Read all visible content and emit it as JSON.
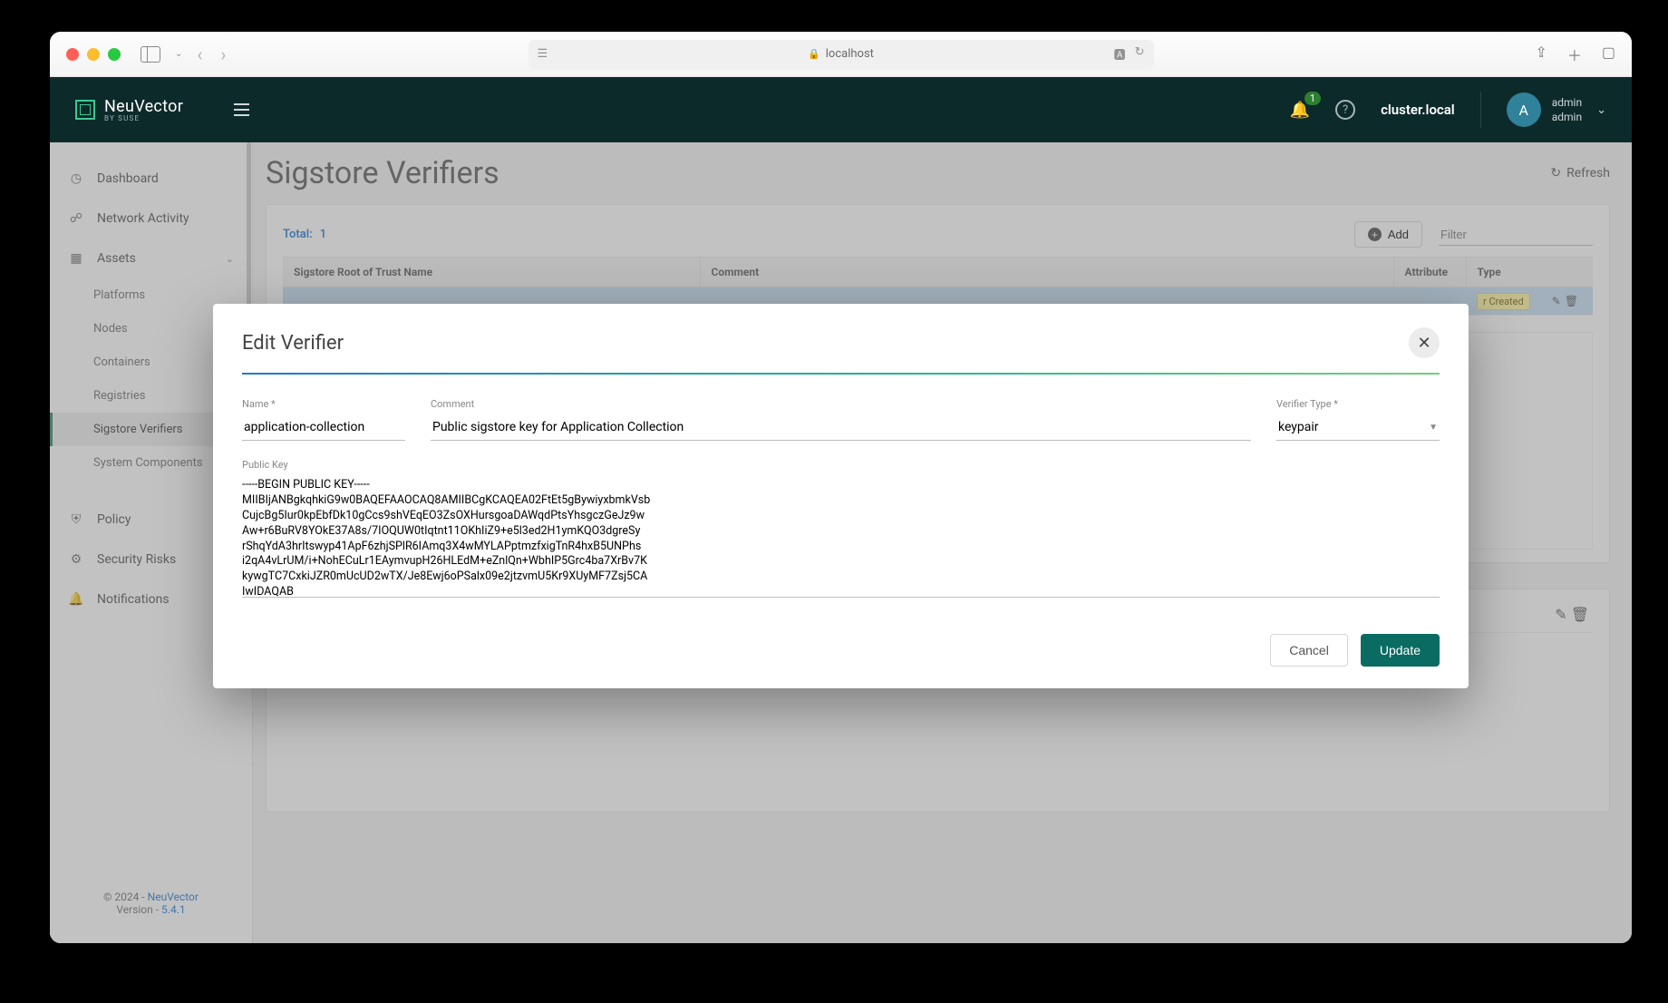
{
  "browser": {
    "url_host": "localhost"
  },
  "header": {
    "logo_text": "NeuVector",
    "logo_sub": "BY SUSE",
    "notification_badge": "1",
    "cluster_name": "cluster.local",
    "avatar_initial": "A",
    "user_line1": "admin",
    "user_line2": "admin"
  },
  "sidebar": {
    "items": [
      {
        "label": "Dashboard"
      },
      {
        "label": "Network Activity"
      },
      {
        "label": "Assets"
      },
      {
        "label": "Platforms"
      },
      {
        "label": "Nodes"
      },
      {
        "label": "Containers"
      },
      {
        "label": "Registries"
      },
      {
        "label": "Sigstore Verifiers"
      },
      {
        "label": "System Components"
      },
      {
        "label": "Policy"
      },
      {
        "label": "Security Risks"
      },
      {
        "label": "Notifications"
      }
    ],
    "footer": {
      "copyright_prefix": "© 2024 - ",
      "brand": "NeuVector",
      "version_prefix": "Version - ",
      "version": "5.4.1"
    }
  },
  "main": {
    "title": "Sigstore Verifiers",
    "refresh_label": "Refresh",
    "total_label": "Total:",
    "total_value": "1",
    "add_label": "Add",
    "filter_placeholder": "Filter",
    "columns": {
      "c1": "Sigstore Root of Trust Name",
      "c2": "Comment",
      "c3": "Attribute",
      "c4": "Type"
    },
    "row_badge": "r Created"
  },
  "modal": {
    "title": "Edit Verifier",
    "name_label": "Name *",
    "name_value": "application-collection",
    "comment_label": "Comment",
    "comment_value": "Public sigstore key for Application Collection",
    "type_label": "Verifier Type *",
    "type_value": "keypair",
    "key_label": "Public Key",
    "key_value": "-----BEGIN PUBLIC KEY-----\nMIIBIjANBgkqhkiG9w0BAQEFAAOCAQ8AMIIBCgKCAQEA02FtEt5gBywiyxbmkVsb\nCujcBg5Iur0kpEbfDk10gCcs9shVEqEO3ZsOXHursgoaDAWqdPtsYhsgczGeJz9w\nAw+r6BuRV8YOkE37A8s/7IOQUW0tIqtnt11OKhIiZ9+e5l3ed2H1ymKQO3dgreSy\nrShqYdA3hrItswyp41ApF6zhjSPlR6IAmq3X4wMYLAPptmzfxigTnR4hxB5UNPhs\ni2qA4vLrUM/i+NohECuLr1EAymvupH26HLEdM+eZnlQn+WbhIP5Grc4ba7XrBv7K\nkywgTC7CxkiJZR0mUcUD2wTX/Je8Ewj6oPSalx09e2jtzvmU5Kr9XUyMF7Zsj5CA\nIwIDAQAB\n-----END PUBLIC KEY-----",
    "cancel_label": "Cancel",
    "update_label": "Update"
  }
}
